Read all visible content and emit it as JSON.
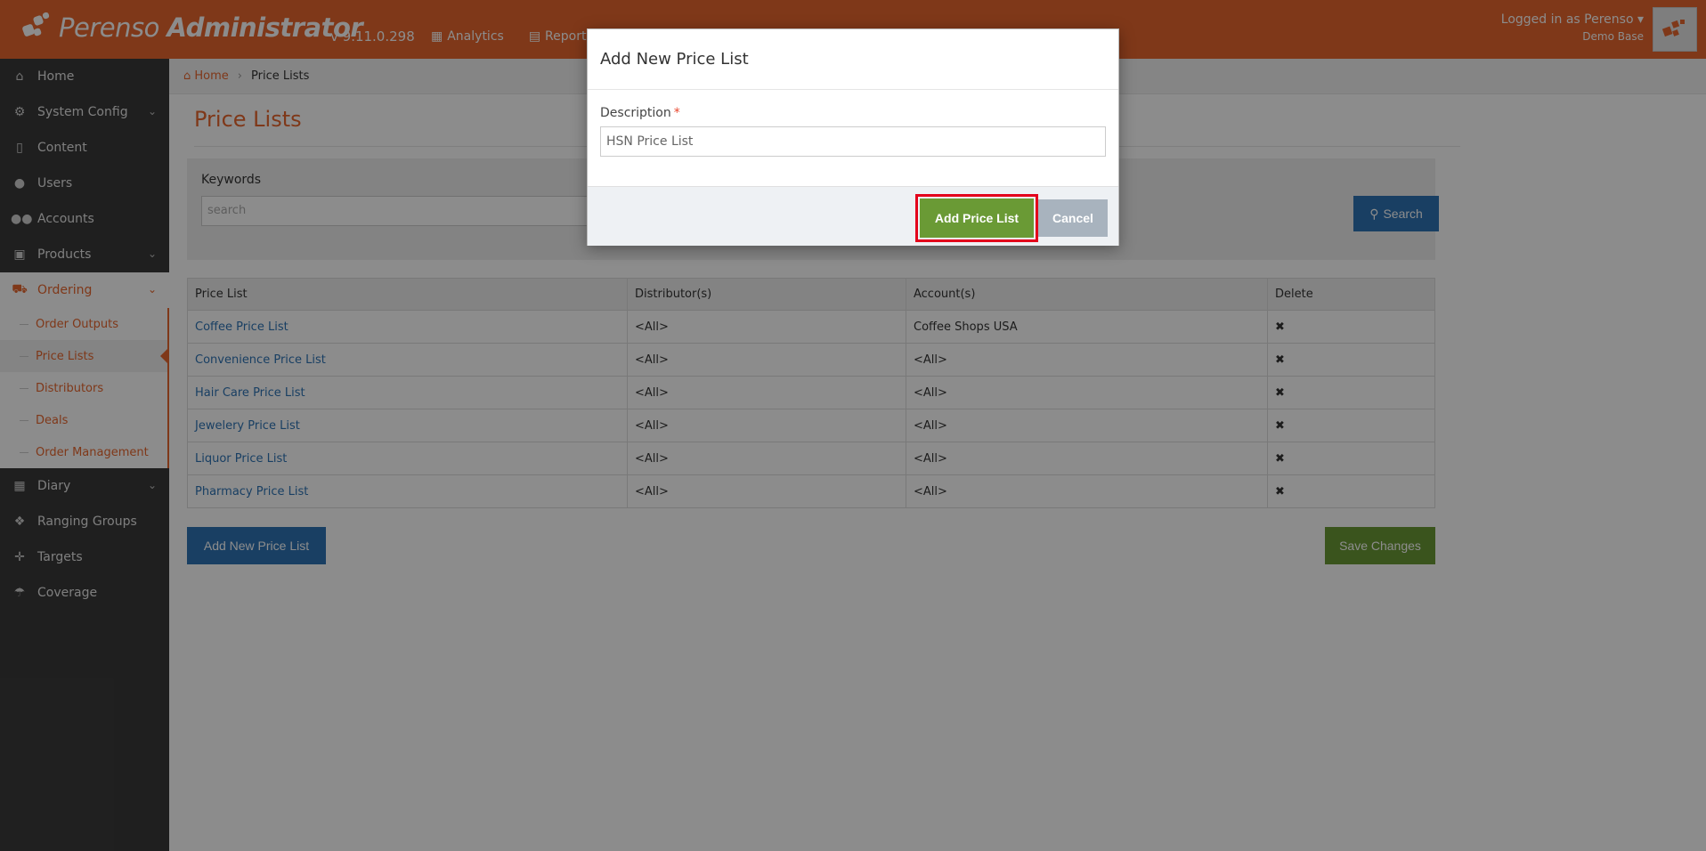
{
  "app": {
    "logo_brand": "Perenso",
    "logo_suffix": "Administrator",
    "version": "v 9.11.0.298"
  },
  "topnav": [
    {
      "label": "Analytics",
      "icon": "chart-icon"
    },
    {
      "label": "Reports",
      "icon": "table-icon"
    }
  ],
  "user": {
    "logged_in": "Logged in as Perenso",
    "base": "Demo Base"
  },
  "sidebar": {
    "items": [
      {
        "label": "Home",
        "icon": "home-icon"
      },
      {
        "label": "System Config",
        "icon": "gear-icon"
      },
      {
        "label": "Content",
        "icon": "file-icon"
      },
      {
        "label": "Users",
        "icon": "user-icon"
      },
      {
        "label": "Accounts",
        "icon": "users-icon"
      },
      {
        "label": "Products",
        "icon": "gift-icon"
      },
      {
        "label": "Ordering",
        "icon": "cart-icon"
      },
      {
        "label": "Diary",
        "icon": "calendar-icon"
      },
      {
        "label": "Ranging Groups",
        "icon": "cubes-icon"
      },
      {
        "label": "Targets",
        "icon": "crosshair-icon"
      },
      {
        "label": "Coverage",
        "icon": "umbrella-icon"
      }
    ],
    "ordering_sub": [
      {
        "label": "Order Outputs"
      },
      {
        "label": "Price Lists"
      },
      {
        "label": "Distributors"
      },
      {
        "label": "Deals"
      },
      {
        "label": "Order Management"
      }
    ]
  },
  "breadcrumb": {
    "home": "Home",
    "current": "Price Lists"
  },
  "page": {
    "title": "Price Lists",
    "keywords_label": "Keywords",
    "search_placeholder": "search",
    "search_button": "Search",
    "add_button": "Add New Price List",
    "save_button": "Save Changes"
  },
  "table": {
    "columns": [
      "Price List",
      "Distributor(s)",
      "Account(s)",
      "Delete"
    ],
    "rows": [
      {
        "name": "Coffee Price List",
        "distributors": "<All>",
        "accounts": "Coffee Shops USA"
      },
      {
        "name": "Convenience Price List",
        "distributors": "<All>",
        "accounts": "<All>"
      },
      {
        "name": "Hair Care Price List",
        "distributors": "<All>",
        "accounts": "<All>"
      },
      {
        "name": "Jewelery Price List",
        "distributors": "<All>",
        "accounts": "<All>"
      },
      {
        "name": "Liquor Price List",
        "distributors": "<All>",
        "accounts": "<All>"
      },
      {
        "name": "Pharmacy Price List",
        "distributors": "<All>",
        "accounts": "<All>"
      }
    ],
    "delete_glyph": "✖"
  },
  "modal": {
    "title": "Add New Price List",
    "field_label": "Description",
    "required_mark": "*",
    "field_value": "HSN Price List",
    "primary_button": "Add Price List",
    "cancel_button": "Cancel"
  },
  "colors": {
    "brand": "#e8662e",
    "primary_blue": "#2e74b5",
    "success_green": "#6a9a35",
    "highlight_red": "#e3001b"
  }
}
